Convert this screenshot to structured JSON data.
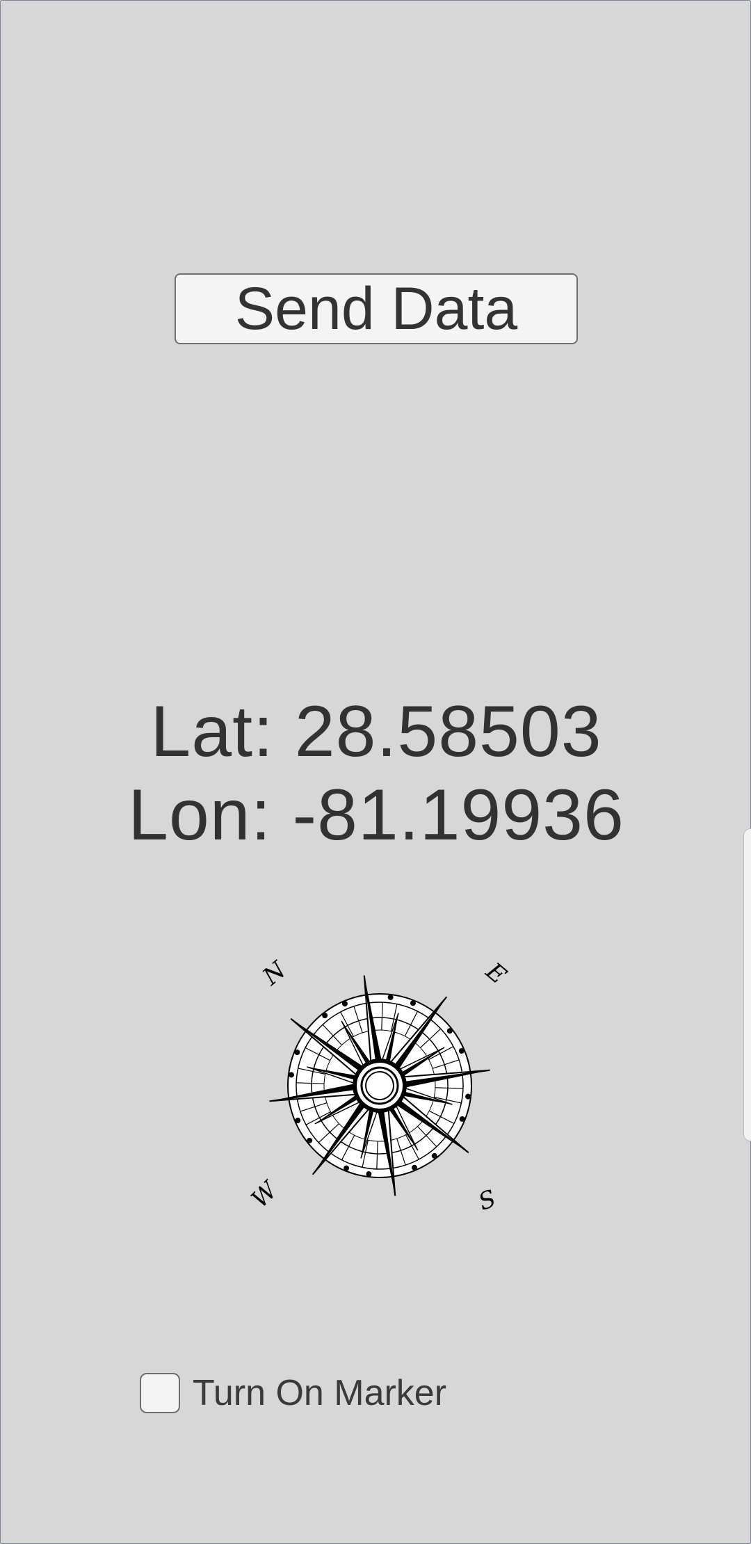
{
  "send_button": {
    "label": "Send Data"
  },
  "coordinates": {
    "lat_label": "Lat:",
    "lat_value": "28.58503",
    "lon_label": "Lon:",
    "lon_value": "-81.19936"
  },
  "compass": {
    "icon": "compass-rose-icon",
    "labels": {
      "north": "N",
      "east": "E",
      "south": "S",
      "west": "W"
    }
  },
  "marker_toggle": {
    "label": "Turn On Marker",
    "checked": false
  },
  "colors": {
    "background": "#d7d7d7",
    "button_fill": "#f4f4f4",
    "text": "#333333",
    "compass": "#000000"
  }
}
